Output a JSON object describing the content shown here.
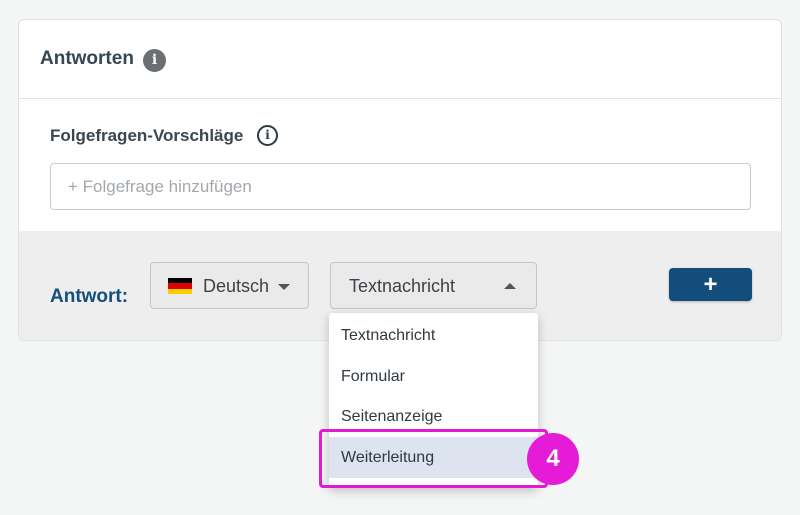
{
  "card": {
    "title": "Antworten",
    "title_info_icon": "info-icon",
    "followups": {
      "label": "Folgefragen-Vorschläge",
      "info_icon": "info-outline-icon",
      "input_placeholder": "+ Folgefrage hinzufügen",
      "input_value": ""
    },
    "answer": {
      "label": "Antwort:",
      "language": {
        "flag_icon": "germany-flag-icon",
        "selected": "Deutsch",
        "flag_colors": [
          "#000000",
          "#dd0000",
          "#ffce00"
        ]
      },
      "type": {
        "selected": "Textnachricht"
      },
      "add_button_label": "+"
    }
  },
  "dropdown": {
    "items": [
      "Textnachricht",
      "Formular",
      "Seitenanzeige",
      "Weiterleitung"
    ],
    "highlighted": "Weiterleitung"
  },
  "annotation": {
    "step": "4",
    "color": "#e61bd8"
  },
  "colors": {
    "accent": "#124d7c",
    "answer_label": "#12507f",
    "highlight": "#e21ad0"
  }
}
